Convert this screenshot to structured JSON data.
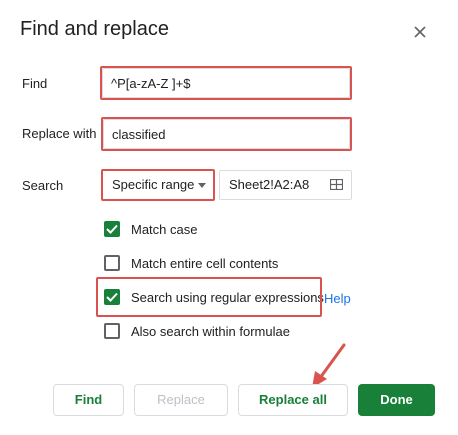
{
  "dialog": {
    "title": "Find and replace",
    "close_icon": "close-icon"
  },
  "find": {
    "label": "Find",
    "value": "^P[a-zA-Z ]+$"
  },
  "replace": {
    "label": "Replace with",
    "value": "classified"
  },
  "search": {
    "label": "Search",
    "scope_selected": "Specific range",
    "range_value": "Sheet2!A2:A8",
    "range_icon": "grid-select-icon"
  },
  "options": [
    {
      "label": "Match case",
      "checked": true
    },
    {
      "label": "Match entire cell contents",
      "checked": false
    },
    {
      "label": "Search using regular expressions",
      "checked": true
    },
    {
      "label": "Also search within formulae",
      "checked": false
    }
  ],
  "help_link": "Help",
  "buttons": {
    "find": "Find",
    "replace": "Replace",
    "replace_all": "Replace all",
    "done": "Done"
  },
  "colors": {
    "accent": "#188038",
    "highlight": "#d9534f",
    "link": "#1a73e8"
  }
}
